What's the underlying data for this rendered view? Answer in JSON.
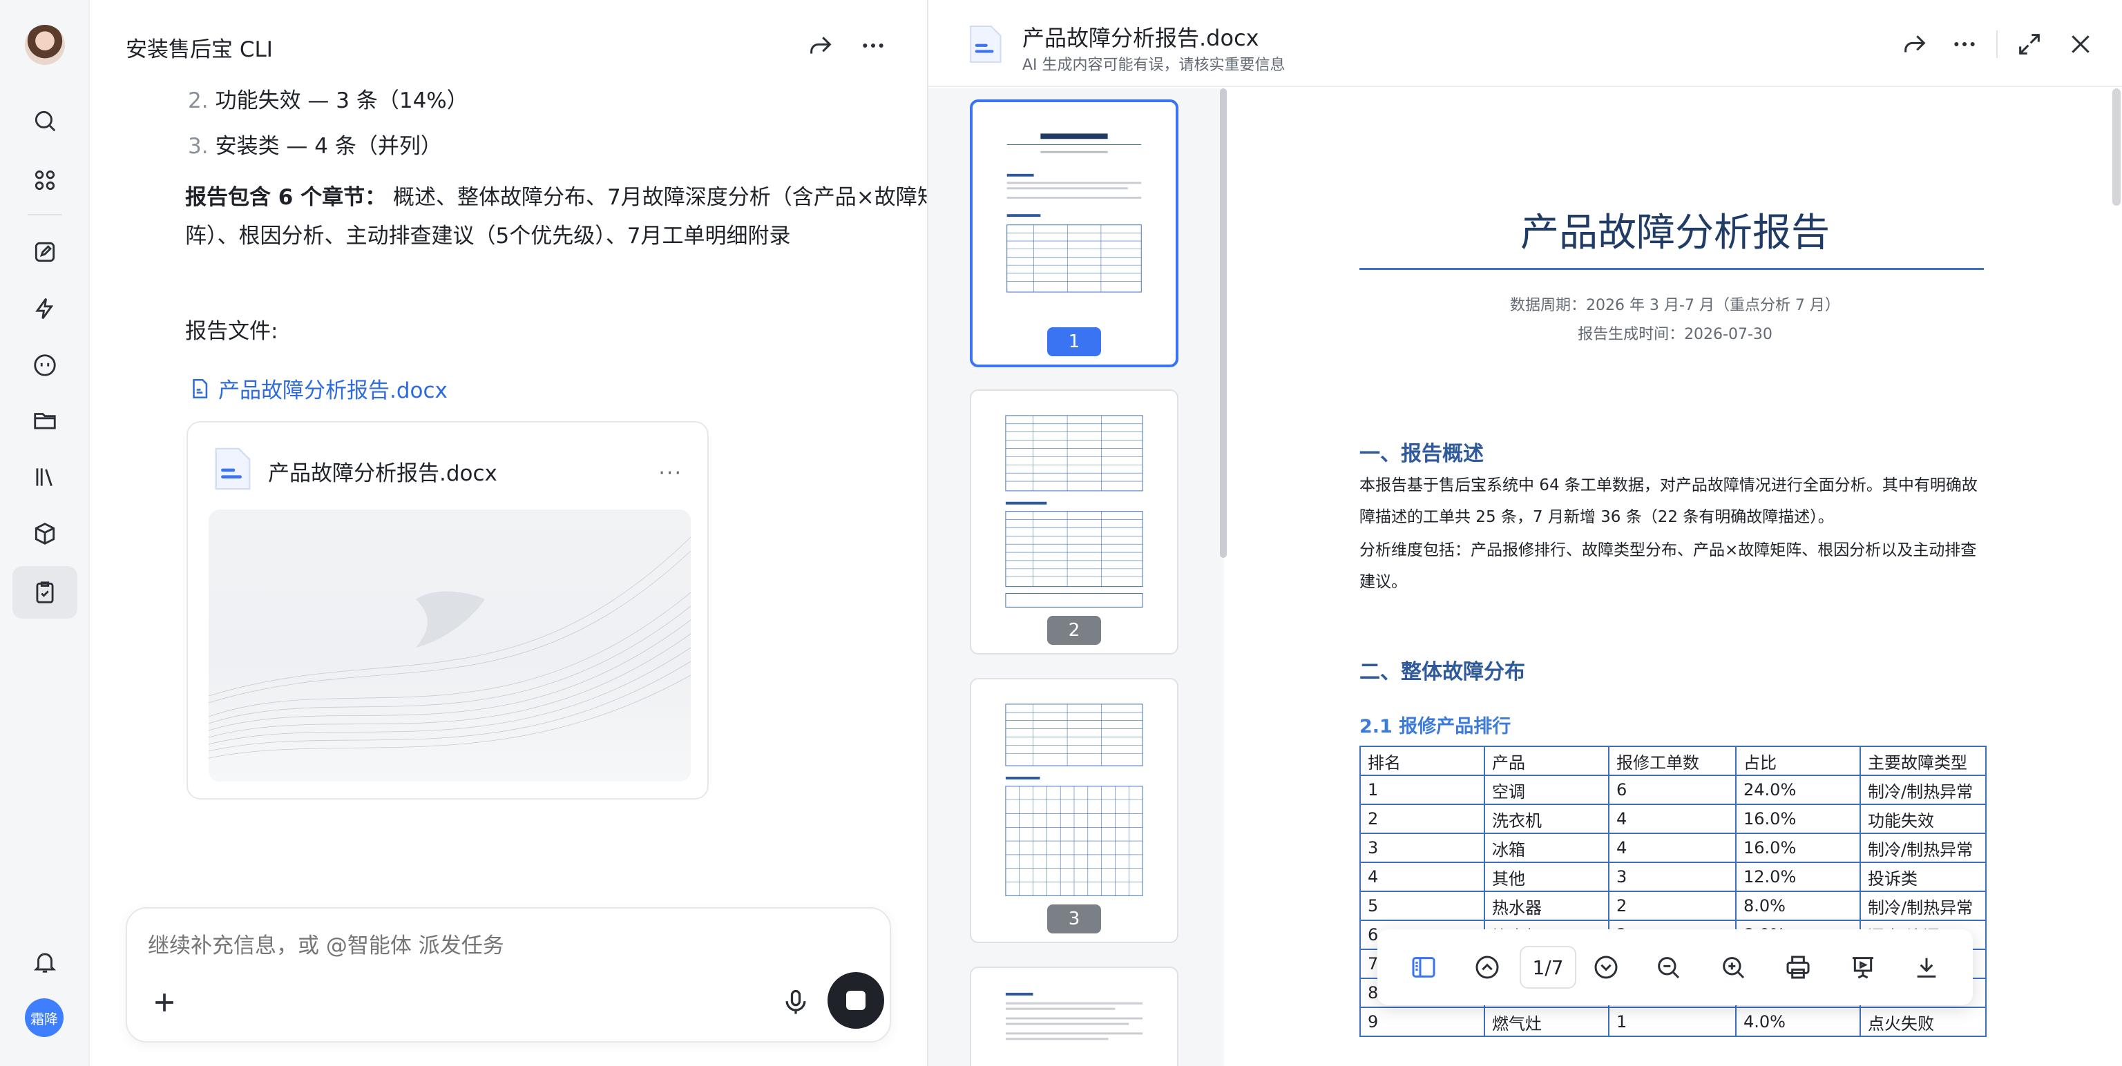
{
  "chat": {
    "title": "安装售后宝 CLI",
    "list": [
      {
        "num": "2.",
        "text": "功能失效 — 3 条（14%）"
      },
      {
        "num": "3.",
        "text": "安装类 — 4 条（并列）"
      }
    ],
    "report_label": "报告包含 6 个章节：",
    "report_chapters": "概述、整体故障分布、7月故障深度分析（含产品×故障矩阵）、根因分析、主动排查建议（5个优先级）、7月工单明细附录",
    "file_label": "报告文件:",
    "file_link": "产品故障分析报告.docx",
    "card_file_name": "产品故障分析报告.docx",
    "card_more": "···",
    "input_placeholder": "继续补充信息，或 @智能体 派发任务"
  },
  "nav": {
    "user_badge": "霜降"
  },
  "viewer": {
    "title": "产品故障分析报告.docx",
    "subtitle": "AI 生成内容可能有误，请核实重要信息",
    "thumbnails": [
      {
        "num": "1"
      },
      {
        "num": "2"
      },
      {
        "num": "3"
      }
    ],
    "doc": {
      "title": "产品故障分析报告",
      "period": "数据周期：2026 年 3 月-7 月（重点分析 7 月）",
      "generated": "报告生成时间：2026-07-30",
      "section1": "一、报告概述",
      "section1_p1": "本报告基于售后宝系统中 64 条工单数据，对产品故障情况进行全面分析。其中有明确故障描述的工单共 25 条，7 月新增 36 条（22 条有明确故障描述）。",
      "section1_p2": "分析维度包括：产品报修排行、故障类型分布、产品×故障矩阵、根因分析以及主动排查建议。",
      "section2": "二、整体故障分布",
      "section2_1": "2.1 报修产品排行",
      "table_headers": [
        "排名",
        "产品",
        "报修工单数",
        "占比",
        "主要故障类型"
      ],
      "table_rows": [
        [
          "1",
          "空调",
          "6",
          "24.0%",
          "制冷/制热异常"
        ],
        [
          "2",
          "洗衣机",
          "4",
          "16.0%",
          "功能失效"
        ],
        [
          "3",
          "冰箱",
          "4",
          "16.0%",
          "制冷/制热异常"
        ],
        [
          "4",
          "其他",
          "3",
          "12.0%",
          "投诉类"
        ],
        [
          "5",
          "热水器",
          "2",
          "8.0%",
          "制冷/制热异常"
        ],
        [
          "6",
          "饮水机",
          "2",
          "8.0%",
          "漏水/渗漏"
        ],
        [
          "7",
          "",
          "",
          "",
          ""
        ],
        [
          "8",
          "",
          "",
          "",
          ""
        ],
        [
          "9",
          "燃气灶",
          "1",
          "4.0%",
          "点火失败"
        ]
      ]
    },
    "toolbar": {
      "page_indicator": "1/7"
    }
  }
}
